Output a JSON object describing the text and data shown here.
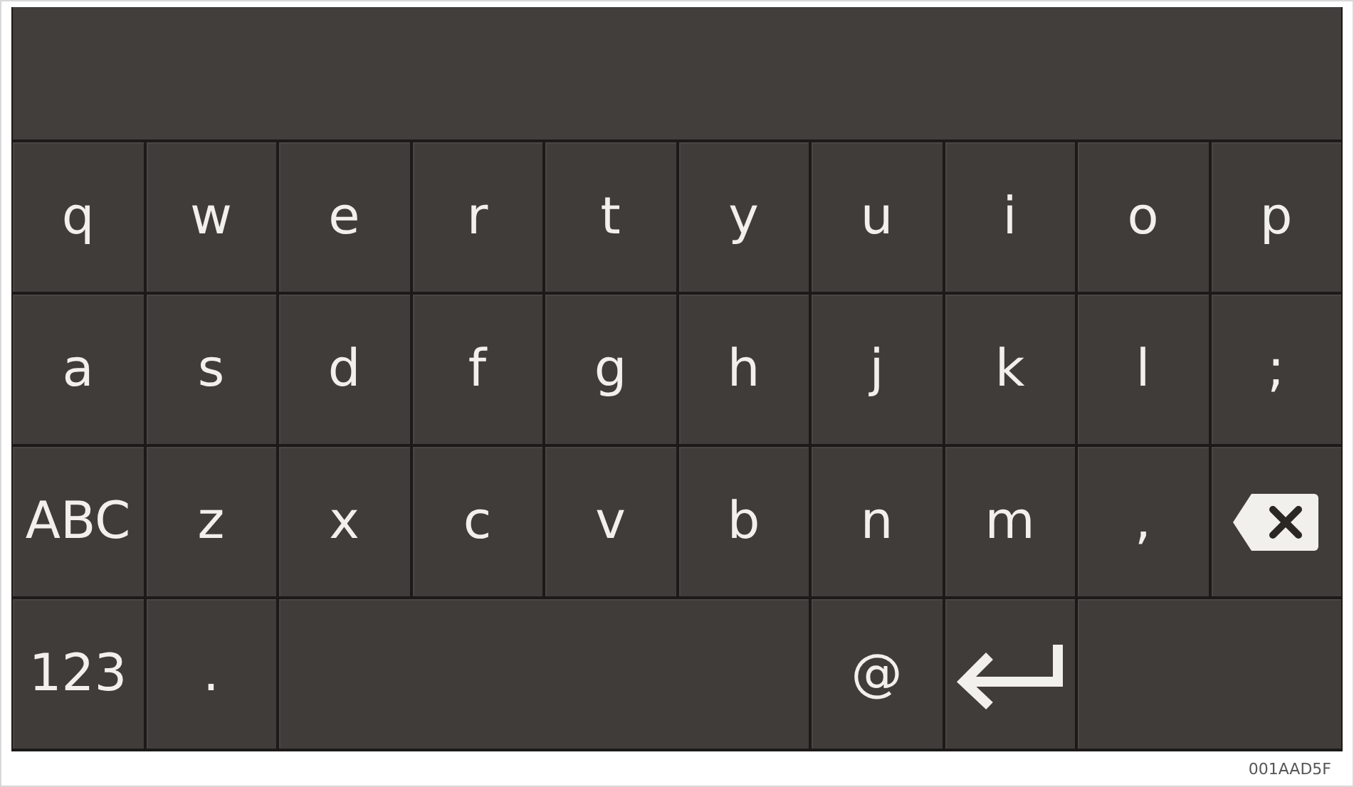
{
  "keyboard": {
    "rows": [
      [
        {
          "kind": "char",
          "label": "q"
        },
        {
          "kind": "char",
          "label": "w"
        },
        {
          "kind": "char",
          "label": "e"
        },
        {
          "kind": "char",
          "label": "r"
        },
        {
          "kind": "char",
          "label": "t"
        },
        {
          "kind": "char",
          "label": "y"
        },
        {
          "kind": "char",
          "label": "u"
        },
        {
          "kind": "char",
          "label": "i"
        },
        {
          "kind": "char",
          "label": "o"
        },
        {
          "kind": "char",
          "label": "p"
        }
      ],
      [
        {
          "kind": "char",
          "label": "a"
        },
        {
          "kind": "char",
          "label": "s"
        },
        {
          "kind": "char",
          "label": "d"
        },
        {
          "kind": "char",
          "label": "f"
        },
        {
          "kind": "char",
          "label": "g"
        },
        {
          "kind": "char",
          "label": "h"
        },
        {
          "kind": "char",
          "label": "j"
        },
        {
          "kind": "char",
          "label": "k"
        },
        {
          "kind": "char",
          "label": "l"
        },
        {
          "kind": "char",
          "label": ";"
        }
      ],
      [
        {
          "kind": "char",
          "label": "ABC"
        },
        {
          "kind": "char",
          "label": "z"
        },
        {
          "kind": "char",
          "label": "x"
        },
        {
          "kind": "char",
          "label": "c"
        },
        {
          "kind": "char",
          "label": "v"
        },
        {
          "kind": "char",
          "label": "b"
        },
        {
          "kind": "char",
          "label": "n"
        },
        {
          "kind": "char",
          "label": "m"
        },
        {
          "kind": "char",
          "label": ","
        },
        {
          "kind": "backspace"
        }
      ],
      [
        {
          "kind": "char",
          "label": "123"
        },
        {
          "kind": "char",
          "label": "."
        },
        {
          "kind": "space"
        },
        "",
        "",
        "",
        {
          "kind": "char",
          "label": "@"
        },
        {
          "kind": "enter"
        },
        {
          "kind": "blank"
        },
        ""
      ]
    ]
  },
  "figure_id": "001AAD5F"
}
